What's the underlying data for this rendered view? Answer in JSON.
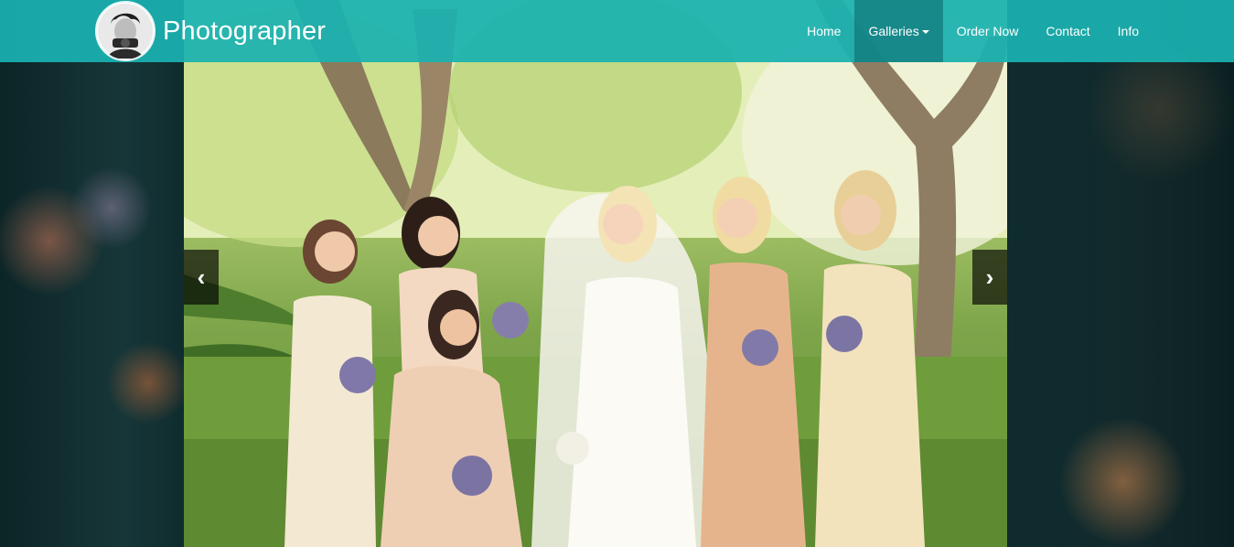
{
  "brand": {
    "title": "Photographer",
    "avatar_icon": "photographer-avatar-icon"
  },
  "nav": {
    "items": [
      {
        "label": "Home"
      },
      {
        "label": "Galleries",
        "has_dropdown": true,
        "active": true
      },
      {
        "label": "Order Now"
      },
      {
        "label": "Contact"
      },
      {
        "label": "Info"
      }
    ]
  },
  "carousel": {
    "prev_glyph": "‹",
    "next_glyph": "›",
    "prev_icon": "chevron-left-icon",
    "next_icon": "chevron-right-icon"
  },
  "colors": {
    "navbar": "#1ab2b0",
    "nav_active": "#0b6468",
    "text": "#ffffff"
  }
}
